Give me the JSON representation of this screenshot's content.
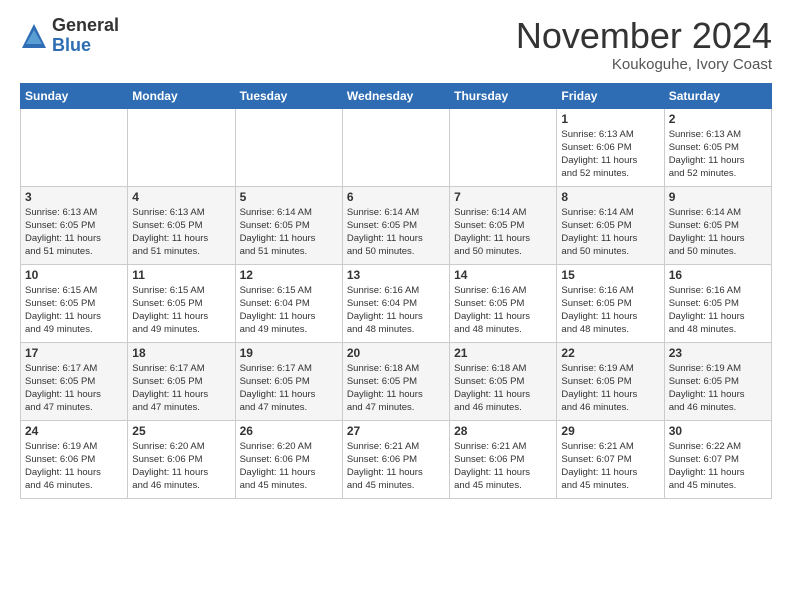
{
  "logo": {
    "general": "General",
    "blue": "Blue"
  },
  "title": "November 2024",
  "location": "Koukoguhe, Ivory Coast",
  "days_header": [
    "Sunday",
    "Monday",
    "Tuesday",
    "Wednesday",
    "Thursday",
    "Friday",
    "Saturday"
  ],
  "weeks": [
    {
      "row_class": "week-row-odd",
      "days": [
        {
          "num": "",
          "info": ""
        },
        {
          "num": "",
          "info": ""
        },
        {
          "num": "",
          "info": ""
        },
        {
          "num": "",
          "info": ""
        },
        {
          "num": "",
          "info": ""
        },
        {
          "num": "1",
          "info": "Sunrise: 6:13 AM\nSunset: 6:06 PM\nDaylight: 11 hours\nand 52 minutes."
        },
        {
          "num": "2",
          "info": "Sunrise: 6:13 AM\nSunset: 6:05 PM\nDaylight: 11 hours\nand 52 minutes."
        }
      ]
    },
    {
      "row_class": "week-row-even",
      "days": [
        {
          "num": "3",
          "info": "Sunrise: 6:13 AM\nSunset: 6:05 PM\nDaylight: 11 hours\nand 51 minutes."
        },
        {
          "num": "4",
          "info": "Sunrise: 6:13 AM\nSunset: 6:05 PM\nDaylight: 11 hours\nand 51 minutes."
        },
        {
          "num": "5",
          "info": "Sunrise: 6:14 AM\nSunset: 6:05 PM\nDaylight: 11 hours\nand 51 minutes."
        },
        {
          "num": "6",
          "info": "Sunrise: 6:14 AM\nSunset: 6:05 PM\nDaylight: 11 hours\nand 50 minutes."
        },
        {
          "num": "7",
          "info": "Sunrise: 6:14 AM\nSunset: 6:05 PM\nDaylight: 11 hours\nand 50 minutes."
        },
        {
          "num": "8",
          "info": "Sunrise: 6:14 AM\nSunset: 6:05 PM\nDaylight: 11 hours\nand 50 minutes."
        },
        {
          "num": "9",
          "info": "Sunrise: 6:14 AM\nSunset: 6:05 PM\nDaylight: 11 hours\nand 50 minutes."
        }
      ]
    },
    {
      "row_class": "week-row-odd",
      "days": [
        {
          "num": "10",
          "info": "Sunrise: 6:15 AM\nSunset: 6:05 PM\nDaylight: 11 hours\nand 49 minutes."
        },
        {
          "num": "11",
          "info": "Sunrise: 6:15 AM\nSunset: 6:05 PM\nDaylight: 11 hours\nand 49 minutes."
        },
        {
          "num": "12",
          "info": "Sunrise: 6:15 AM\nSunset: 6:04 PM\nDaylight: 11 hours\nand 49 minutes."
        },
        {
          "num": "13",
          "info": "Sunrise: 6:16 AM\nSunset: 6:04 PM\nDaylight: 11 hours\nand 48 minutes."
        },
        {
          "num": "14",
          "info": "Sunrise: 6:16 AM\nSunset: 6:05 PM\nDaylight: 11 hours\nand 48 minutes."
        },
        {
          "num": "15",
          "info": "Sunrise: 6:16 AM\nSunset: 6:05 PM\nDaylight: 11 hours\nand 48 minutes."
        },
        {
          "num": "16",
          "info": "Sunrise: 6:16 AM\nSunset: 6:05 PM\nDaylight: 11 hours\nand 48 minutes."
        }
      ]
    },
    {
      "row_class": "week-row-even",
      "days": [
        {
          "num": "17",
          "info": "Sunrise: 6:17 AM\nSunset: 6:05 PM\nDaylight: 11 hours\nand 47 minutes."
        },
        {
          "num": "18",
          "info": "Sunrise: 6:17 AM\nSunset: 6:05 PM\nDaylight: 11 hours\nand 47 minutes."
        },
        {
          "num": "19",
          "info": "Sunrise: 6:17 AM\nSunset: 6:05 PM\nDaylight: 11 hours\nand 47 minutes."
        },
        {
          "num": "20",
          "info": "Sunrise: 6:18 AM\nSunset: 6:05 PM\nDaylight: 11 hours\nand 47 minutes."
        },
        {
          "num": "21",
          "info": "Sunrise: 6:18 AM\nSunset: 6:05 PM\nDaylight: 11 hours\nand 46 minutes."
        },
        {
          "num": "22",
          "info": "Sunrise: 6:19 AM\nSunset: 6:05 PM\nDaylight: 11 hours\nand 46 minutes."
        },
        {
          "num": "23",
          "info": "Sunrise: 6:19 AM\nSunset: 6:05 PM\nDaylight: 11 hours\nand 46 minutes."
        }
      ]
    },
    {
      "row_class": "week-row-odd",
      "days": [
        {
          "num": "24",
          "info": "Sunrise: 6:19 AM\nSunset: 6:06 PM\nDaylight: 11 hours\nand 46 minutes."
        },
        {
          "num": "25",
          "info": "Sunrise: 6:20 AM\nSunset: 6:06 PM\nDaylight: 11 hours\nand 46 minutes."
        },
        {
          "num": "26",
          "info": "Sunrise: 6:20 AM\nSunset: 6:06 PM\nDaylight: 11 hours\nand 45 minutes."
        },
        {
          "num": "27",
          "info": "Sunrise: 6:21 AM\nSunset: 6:06 PM\nDaylight: 11 hours\nand 45 minutes."
        },
        {
          "num": "28",
          "info": "Sunrise: 6:21 AM\nSunset: 6:06 PM\nDaylight: 11 hours\nand 45 minutes."
        },
        {
          "num": "29",
          "info": "Sunrise: 6:21 AM\nSunset: 6:07 PM\nDaylight: 11 hours\nand 45 minutes."
        },
        {
          "num": "30",
          "info": "Sunrise: 6:22 AM\nSunset: 6:07 PM\nDaylight: 11 hours\nand 45 minutes."
        }
      ]
    }
  ]
}
